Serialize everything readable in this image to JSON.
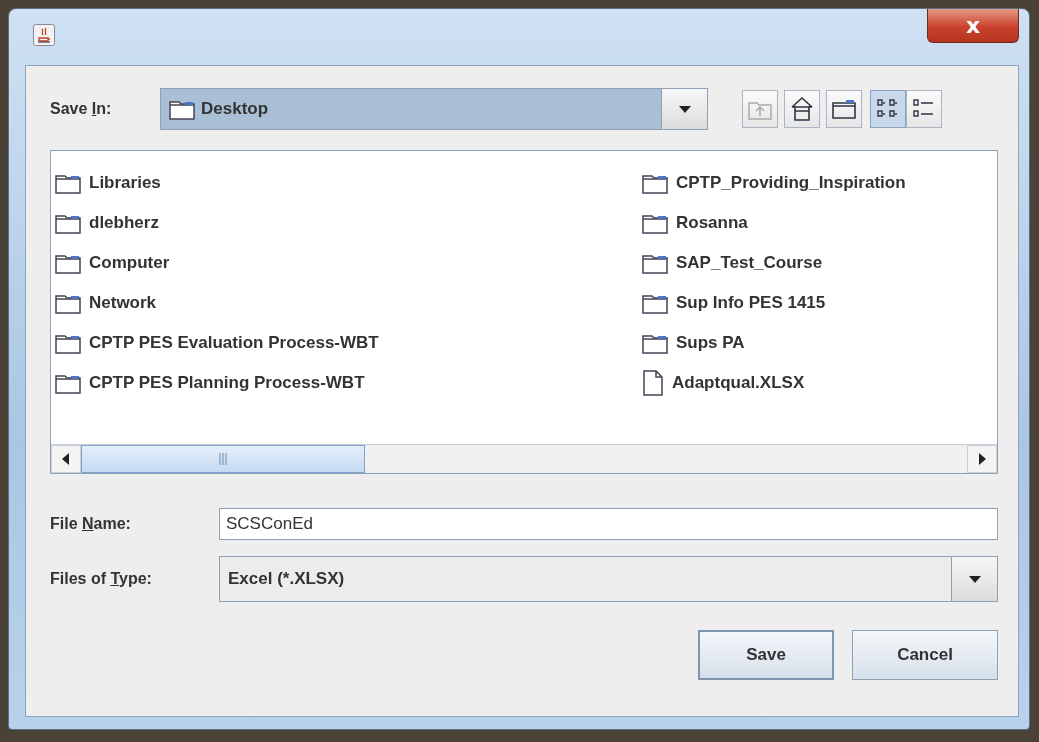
{
  "window": {
    "close_label": "x"
  },
  "save_in": {
    "label_parts": [
      "Save ",
      "I",
      "n:"
    ],
    "value": "Desktop"
  },
  "toolbar": [
    {
      "kind": "up",
      "disabled": true
    },
    {
      "kind": "home",
      "disabled": false
    },
    {
      "kind": "new-folder",
      "disabled": false
    },
    {
      "kind": "list",
      "disabled": false,
      "selected": true
    },
    {
      "kind": "details",
      "disabled": false,
      "selected": false
    }
  ],
  "files": [
    {
      "name": "Libraries",
      "kind": "folder"
    },
    {
      "name": "dlebherz",
      "kind": "folder"
    },
    {
      "name": "Computer",
      "kind": "folder"
    },
    {
      "name": "Network",
      "kind": "folder"
    },
    {
      "name": "CPTP PES Evaluation Process-WBT",
      "kind": "folder"
    },
    {
      "name": "CPTP PES Planning Process-WBT",
      "kind": "folder"
    },
    {
      "name": "CPTP_Providing_Inspiration",
      "kind": "folder"
    },
    {
      "name": "Rosanna",
      "kind": "folder"
    },
    {
      "name": "SAP_Test_Course",
      "kind": "folder"
    },
    {
      "name": "Sup Info PES 1415",
      "kind": "folder"
    },
    {
      "name": "Sups PA",
      "kind": "folder"
    },
    {
      "name": "Adaptqual.XLSX",
      "kind": "file"
    }
  ],
  "file_name": {
    "label_parts": [
      "File ",
      "N",
      "ame:"
    ],
    "value": "SCSConEd"
  },
  "file_type": {
    "label_parts": [
      "Files of ",
      "T",
      "ype:"
    ],
    "value": "Excel (*.XLSX)"
  },
  "buttons": [
    {
      "label": "Save",
      "default": true
    },
    {
      "label": "Cancel",
      "default": false
    }
  ]
}
